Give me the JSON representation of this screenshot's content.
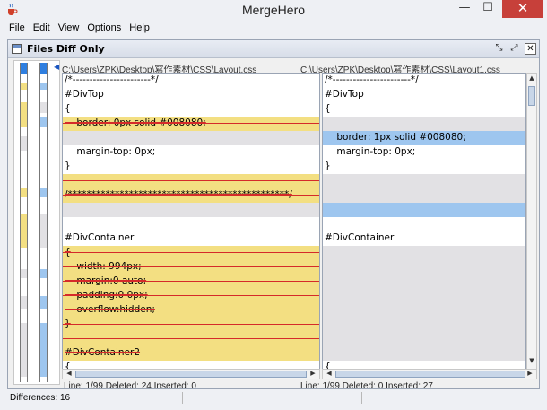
{
  "window": {
    "title": "MergeHero",
    "icon": "java-cup-icon",
    "close_glyph": "✕",
    "min_glyph": "—",
    "max_glyph": "☐"
  },
  "menu": [
    "File",
    "Edit",
    "View",
    "Options",
    "Help"
  ],
  "inner_frame": {
    "title": "Files Diff Only",
    "btn_restore": "⤡",
    "btn_maximize": "⤢",
    "btn_close": "✕"
  },
  "colors": {
    "deleted": "#f3df82",
    "changed": "#9ec6ef",
    "gap": "#e2e1e4",
    "strike": "#d52a2a"
  },
  "left_pane": {
    "path": "C:\\Users\\ZPK\\Desktop\\寫作素材\\CSS\\Layout.css",
    "lines": [
      {
        "text": "/*-----------------------*/",
        "type": "normal"
      },
      {
        "text": "#DivTop",
        "type": "normal"
      },
      {
        "text": "{",
        "type": "normal"
      },
      {
        "text": "    border: 0px solid #008080;",
        "type": "deleted"
      },
      {
        "text": "",
        "type": "gap"
      },
      {
        "text": "    margin-top: 0px;",
        "type": "normal"
      },
      {
        "text": "}",
        "type": "normal"
      },
      {
        "text": "",
        "type": "deleted"
      },
      {
        "text": "/***********************************************/",
        "type": "deleted"
      },
      {
        "text": "",
        "type": "gap"
      },
      {
        "text": "",
        "type": "normal"
      },
      {
        "text": "#DivContainer",
        "type": "normal"
      },
      {
        "text": "{",
        "type": "deleted"
      },
      {
        "text": "    width: 994px;",
        "type": "deleted"
      },
      {
        "text": "    margin:0 auto;",
        "type": "deleted"
      },
      {
        "text": "    padding:0 0px;",
        "type": "deleted"
      },
      {
        "text": "    overflow:hidden;",
        "type": "deleted"
      },
      {
        "text": "}",
        "type": "deleted"
      },
      {
        "text": "",
        "type": "deleted"
      },
      {
        "text": "#DivContainer2",
        "type": "deleted"
      },
      {
        "text": "{",
        "type": "normal"
      }
    ],
    "status": "Line: 1/99  Deleted: 24  Inserted: 0"
  },
  "right_pane": {
    "path": "C:\\Users\\ZPK\\Desktop\\寫作素材\\CSS\\Layout1.css",
    "lines": [
      {
        "text": "/*-----------------------*/",
        "type": "normal"
      },
      {
        "text": "#DivTop",
        "type": "normal"
      },
      {
        "text": "{",
        "type": "normal"
      },
      {
        "text": "",
        "type": "gap"
      },
      {
        "text": "    border: 1px solid #008080;",
        "type": "changed"
      },
      {
        "text": "    margin-top: 0px;",
        "type": "normal"
      },
      {
        "text": "}",
        "type": "normal"
      },
      {
        "text": "",
        "type": "gap"
      },
      {
        "text": "",
        "type": "gap"
      },
      {
        "text": "",
        "type": "changed"
      },
      {
        "text": "",
        "type": "normal"
      },
      {
        "text": "#DivContainer",
        "type": "normal"
      },
      {
        "text": "",
        "type": "gap"
      },
      {
        "text": "",
        "type": "gap"
      },
      {
        "text": "",
        "type": "gap"
      },
      {
        "text": "",
        "type": "gap"
      },
      {
        "text": "",
        "type": "gap"
      },
      {
        "text": "",
        "type": "gap"
      },
      {
        "text": "",
        "type": "gap"
      },
      {
        "text": "",
        "type": "gap"
      },
      {
        "text": "{",
        "type": "normal"
      }
    ],
    "status": "Line: 1/99  Deleted: 0  Inserted: 27"
  },
  "bottom_status": "Differences: 16"
}
